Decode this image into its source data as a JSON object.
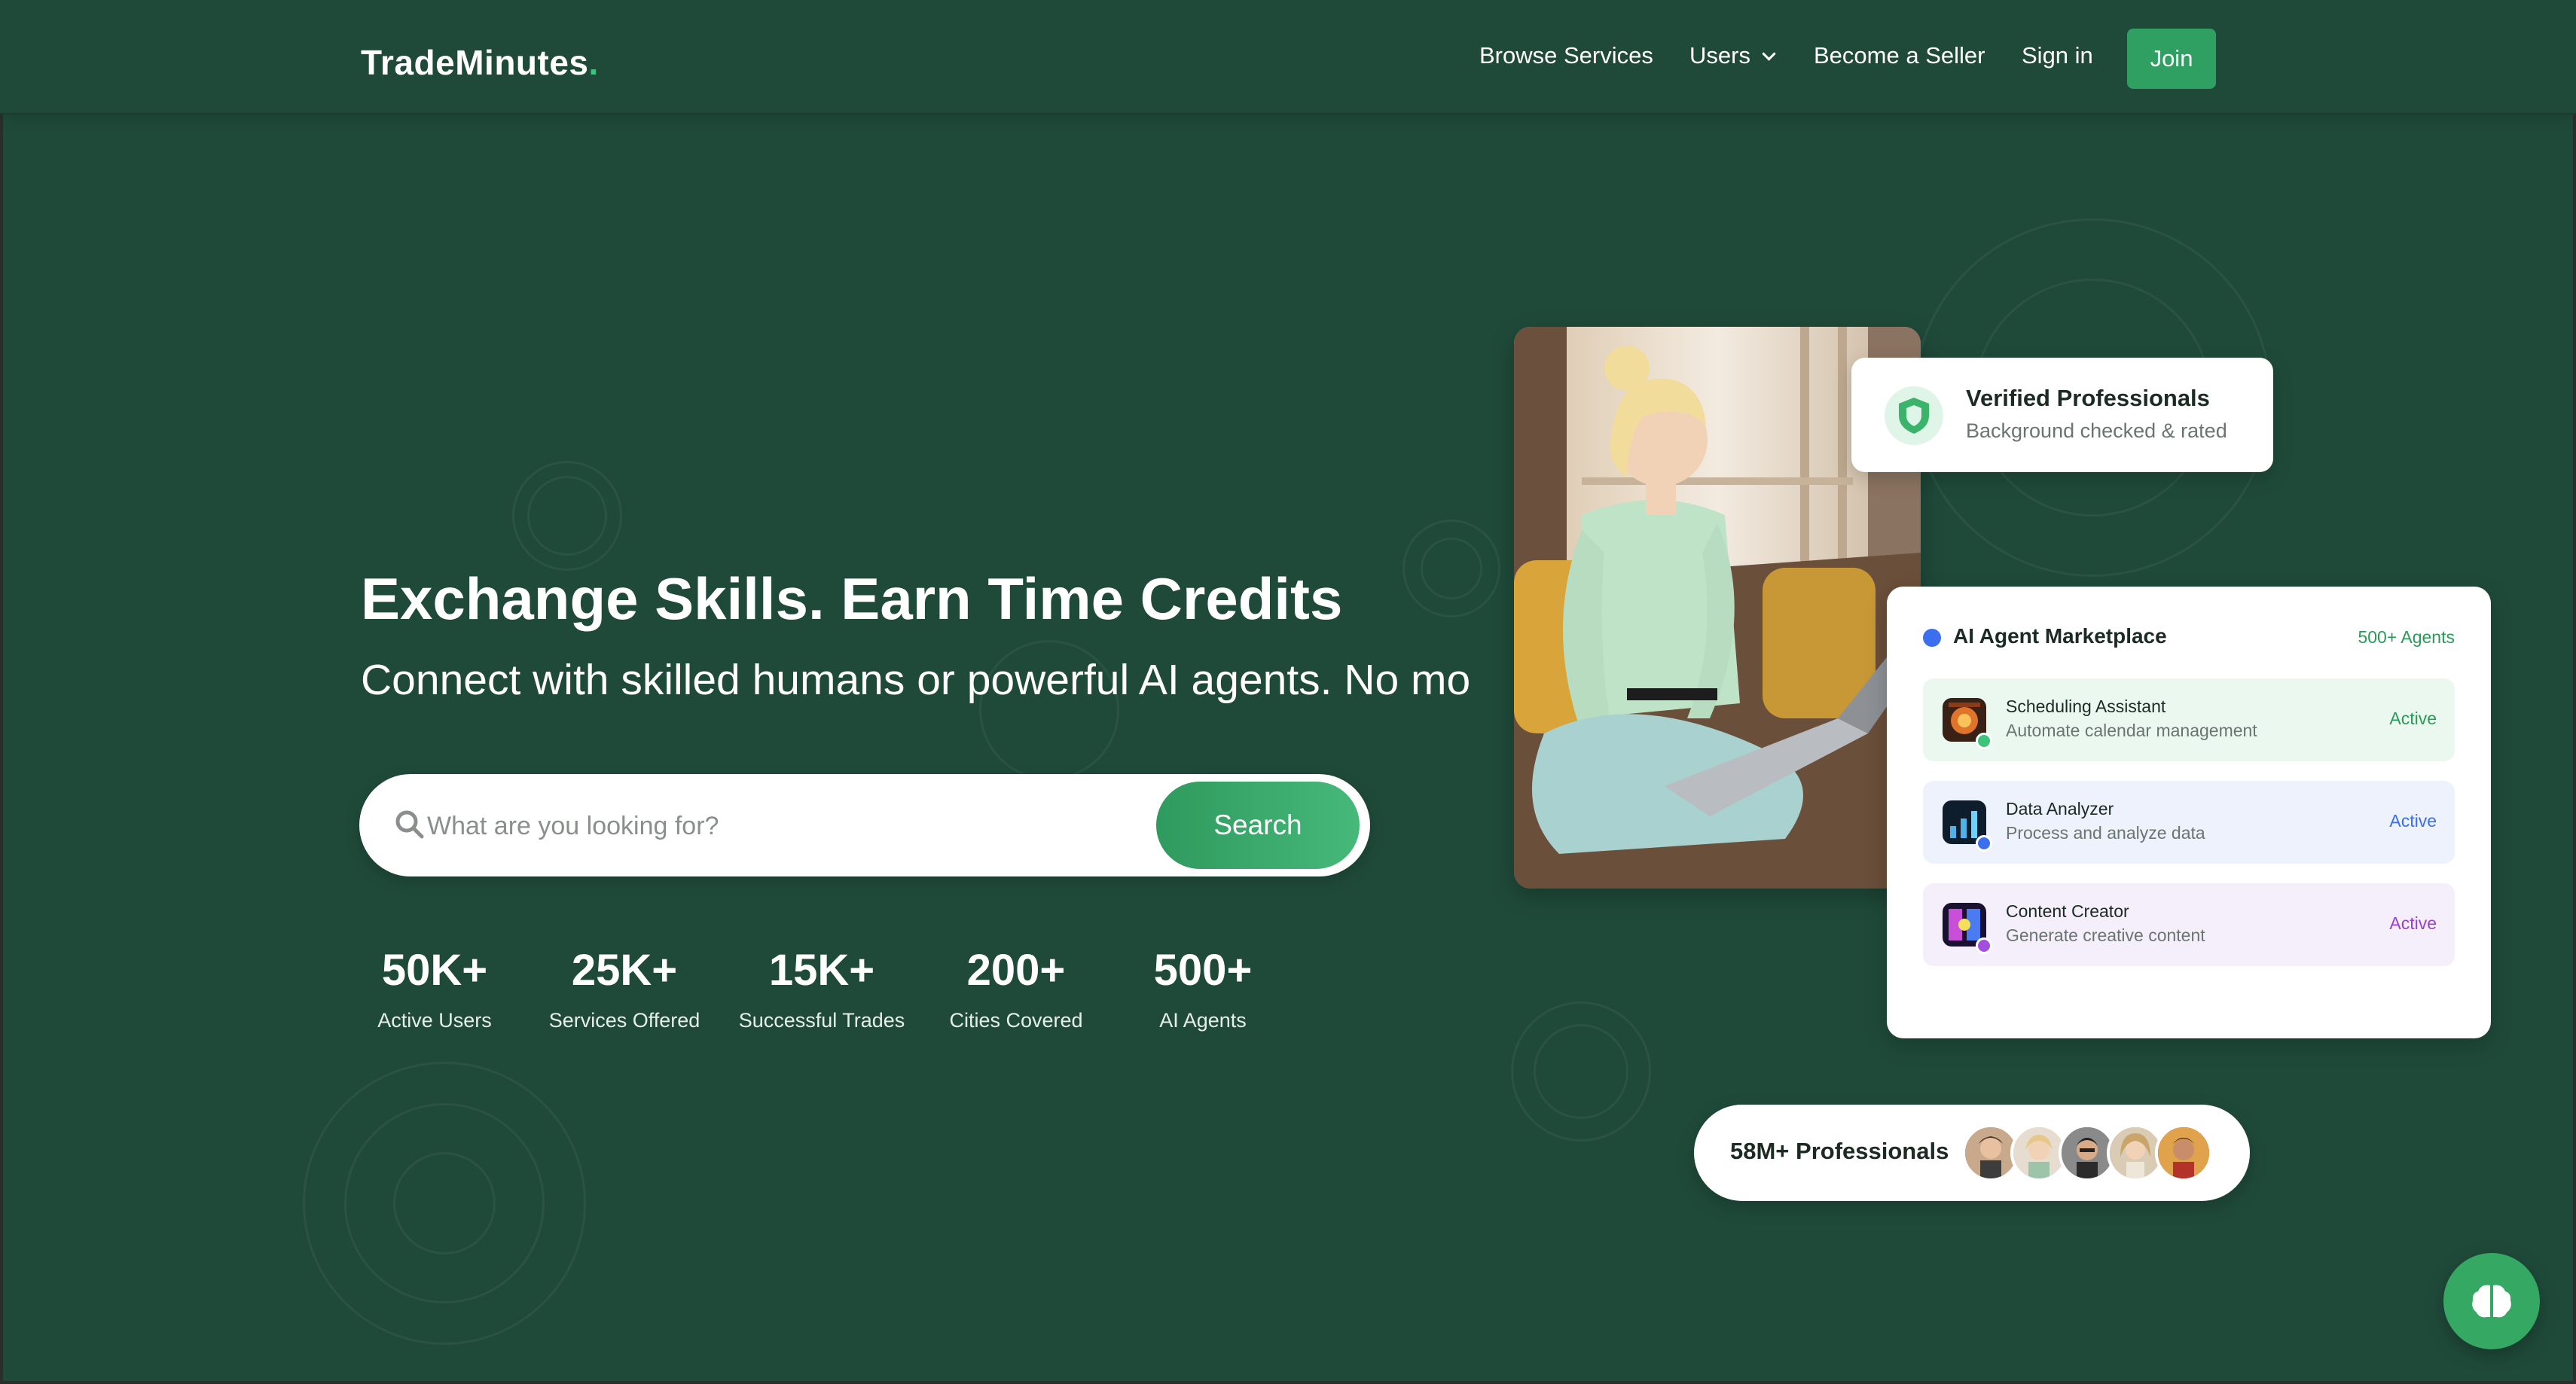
{
  "nav": {
    "logo": "TradeMinutes",
    "logo_dot": ".",
    "links": {
      "browse": "Browse Services",
      "users": "Users",
      "seller": "Become a Seller",
      "signin": "Sign in"
    },
    "join": "Join"
  },
  "hero": {
    "title": "Exchange Skills. Earn Time Credits",
    "subtitle": "Connect with skilled humans or powerful AI agents. No mo"
  },
  "search": {
    "placeholder": "What are you looking for?",
    "button": "Search"
  },
  "stats": [
    {
      "value": "50K+",
      "label": "Active Users"
    },
    {
      "value": "25K+",
      "label": "Services Offered"
    },
    {
      "value": "15K+",
      "label": "Successful Trades"
    },
    {
      "value": "200+",
      "label": "Cities Covered"
    },
    {
      "value": "500+",
      "label": "AI Agents"
    }
  ],
  "verified": {
    "title": "Verified Professionals",
    "subtitle": "Background checked & rated"
  },
  "marketplace": {
    "title": "AI Agent Marketplace",
    "count": "500+ Agents",
    "agents": [
      {
        "name": "Scheduling Assistant",
        "desc": "Automate calendar management",
        "status": "Active"
      },
      {
        "name": "Data Analyzer",
        "desc": "Process and analyze data",
        "status": "Active"
      },
      {
        "name": "Content Creator",
        "desc": "Generate creative content",
        "status": "Active"
      }
    ]
  },
  "professionals": {
    "label": "58M+ Professionals"
  },
  "colors": {
    "background": "#1f4a3a",
    "accent_green": "#2fa061",
    "marketplace_blue": "#3b6ff0",
    "row_green": "#eaf8ef",
    "row_blue": "#edf2fd",
    "row_purple": "#f4effb"
  },
  "icons": {
    "search": "search-icon",
    "shield": "shield-icon",
    "brain": "brain-icon",
    "chevron": "chevron-down-icon"
  }
}
